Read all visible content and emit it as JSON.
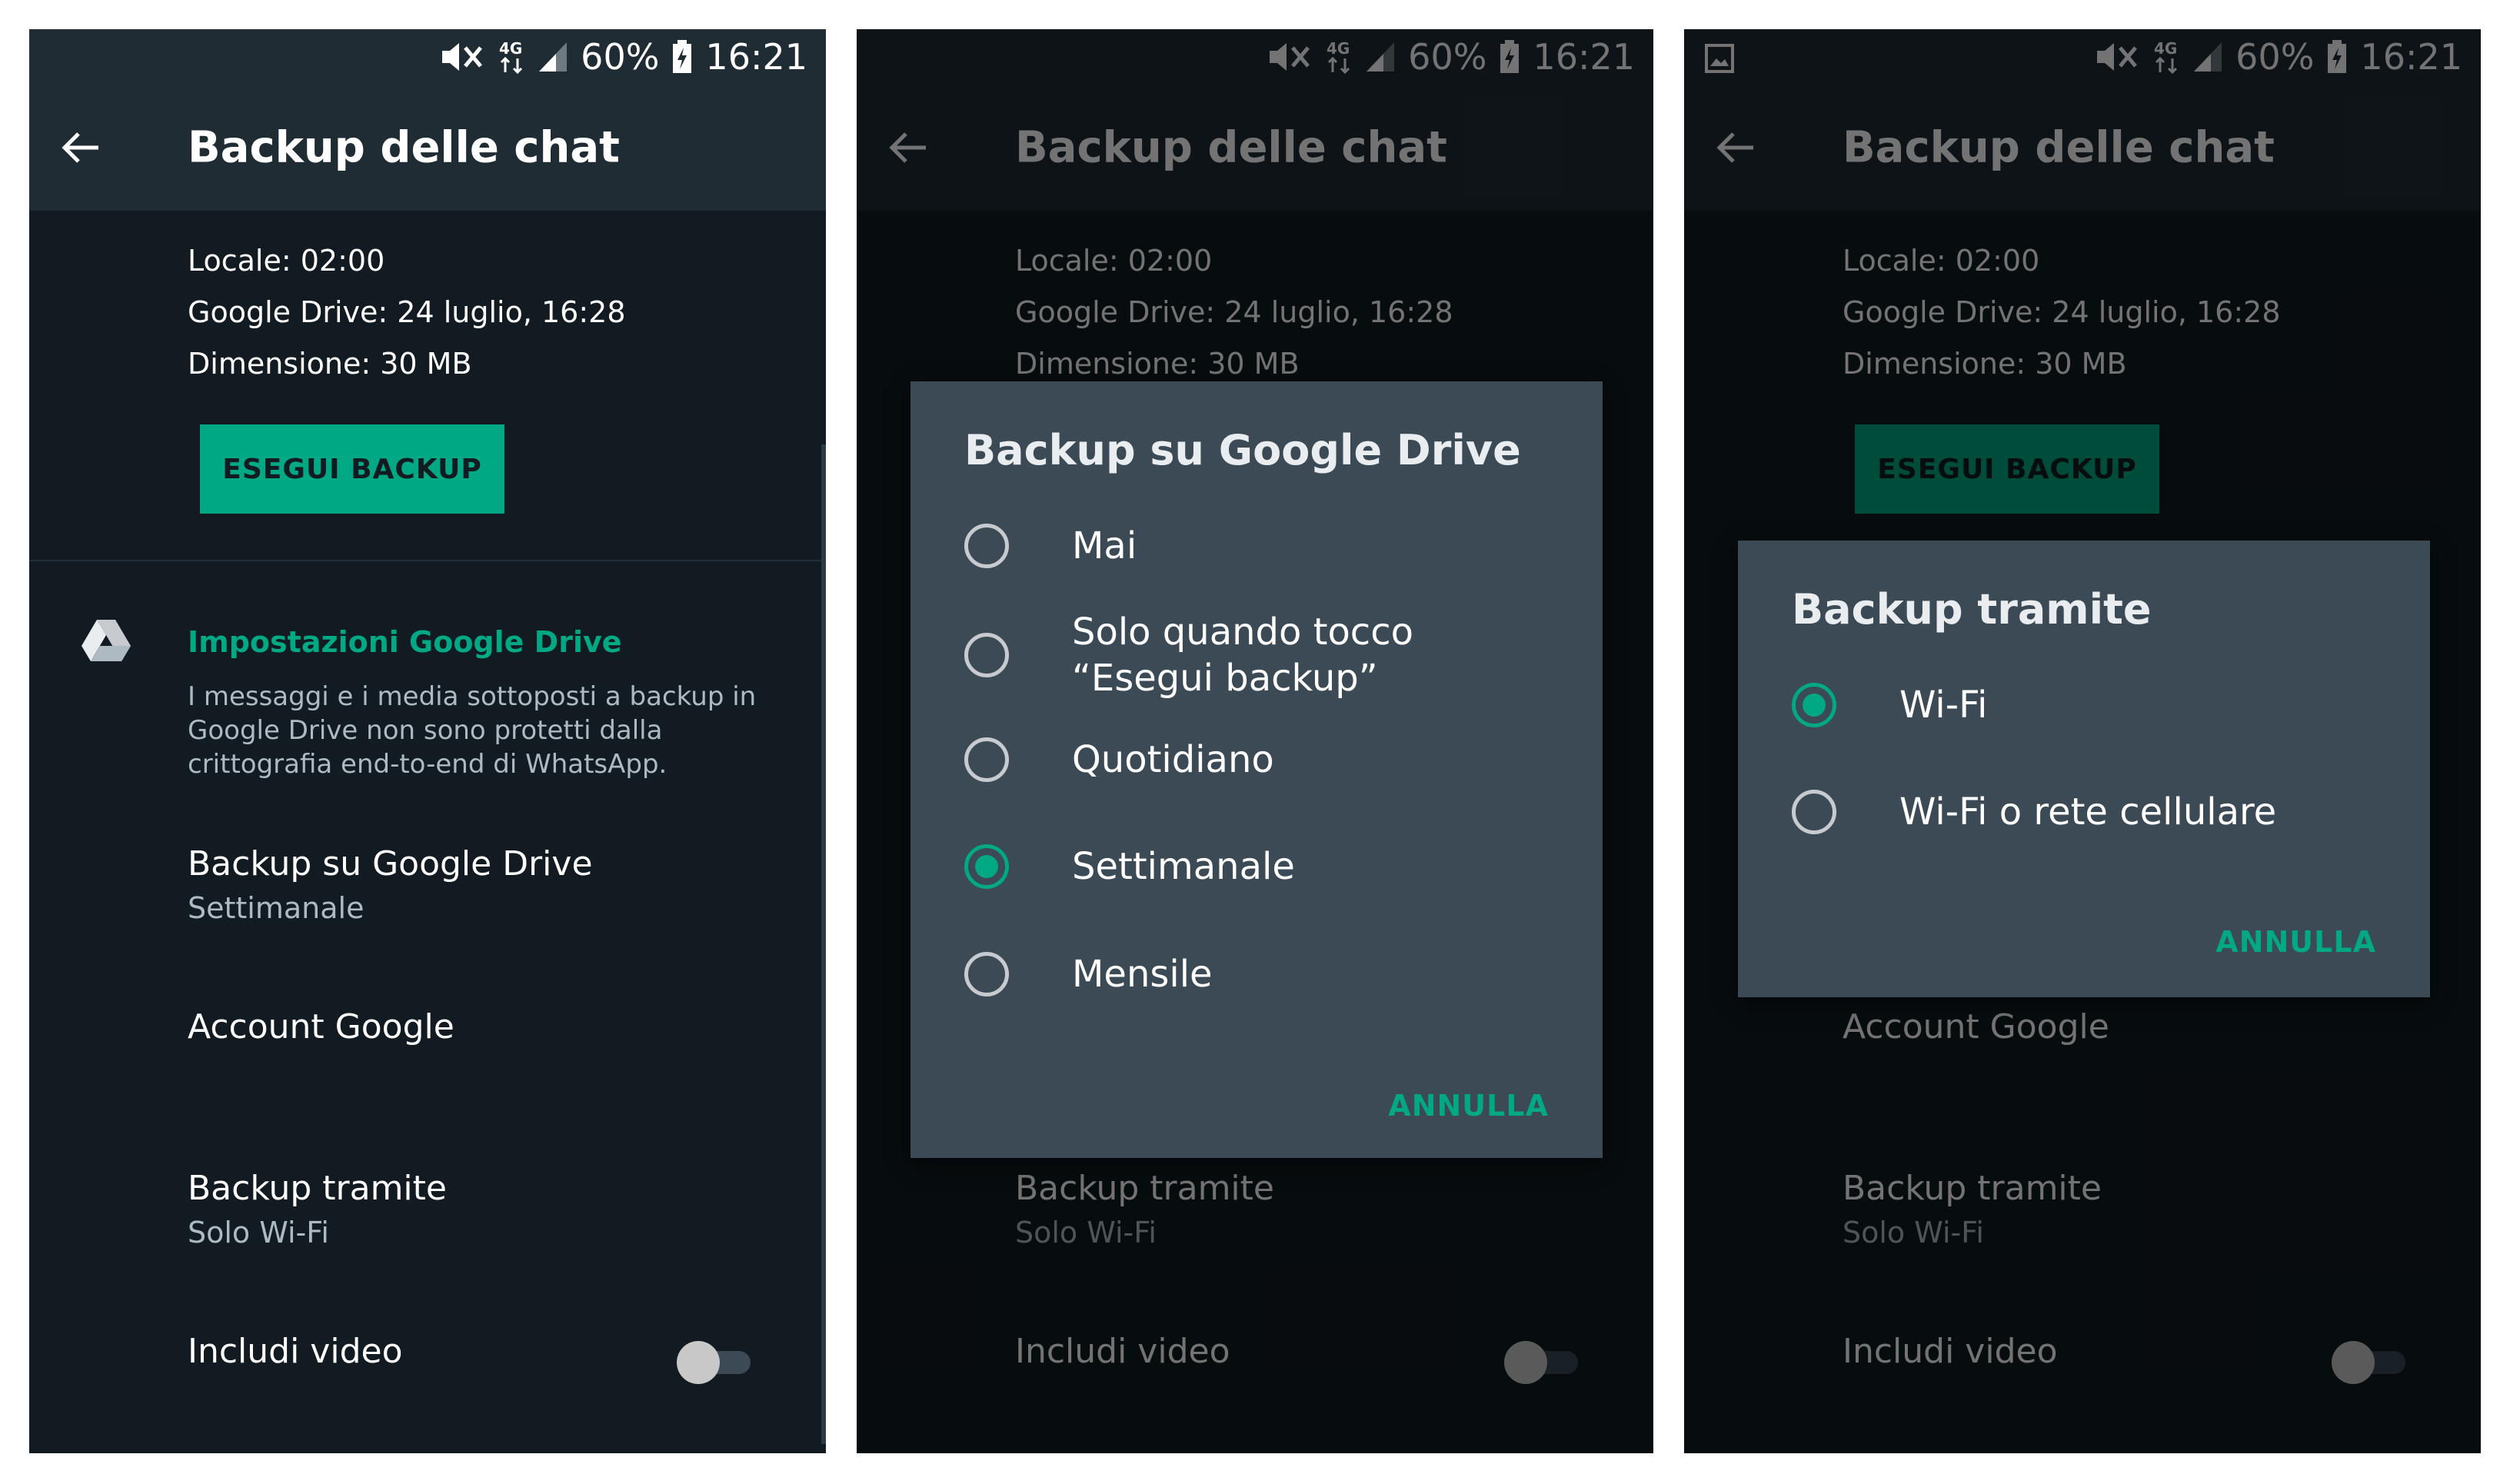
{
  "status": {
    "battery": "60%",
    "time": "16:21"
  },
  "screen": {
    "title": "Backup delle chat",
    "info": [
      "Locale: 02:00",
      "Google Drive: 24 luglio, 16:28",
      "Dimensione: 30 MB"
    ],
    "backup_button": "ESEGUI BACKUP",
    "gd_section_title": "Impostazioni Google Drive",
    "gd_description": "I messaggi e i media sottoposti a backup in Google Drive non sono protetti dalla crittografia end-to-end di WhatsApp.",
    "settings": {
      "gd_backup": {
        "title": "Backup su Google Drive",
        "subtitle": "Settimanale"
      },
      "account": {
        "title": "Account Google"
      },
      "via": {
        "title": "Backup tramite",
        "subtitle": "Solo Wi-Fi"
      },
      "video": {
        "title": "Includi video",
        "enabled": false
      }
    }
  },
  "dialog_frequency": {
    "title": "Backup su Google Drive",
    "options": [
      {
        "label": "Mai",
        "selected": false
      },
      {
        "label": "Solo quando tocco “Esegui backup”",
        "selected": false
      },
      {
        "label": "Quotidiano",
        "selected": false
      },
      {
        "label": "Settimanale",
        "selected": true
      },
      {
        "label": "Mensile",
        "selected": false
      }
    ],
    "cancel": "ANNULLA"
  },
  "dialog_network": {
    "title": "Backup tramite",
    "options": [
      {
        "label": "Wi-Fi",
        "selected": true
      },
      {
        "label": "Wi-Fi o rete cellulare",
        "selected": false
      }
    ],
    "cancel": "ANNULLA"
  },
  "colors": {
    "accent": "#00a884",
    "background": "#111b21",
    "bar": "#1f2c33",
    "dialog": "#3b4a54"
  },
  "icons": [
    "mute-icon",
    "4g-icon",
    "signal-icon",
    "battery-charging-icon",
    "gallery-icon",
    "back-arrow-icon",
    "google-drive-icon"
  ]
}
